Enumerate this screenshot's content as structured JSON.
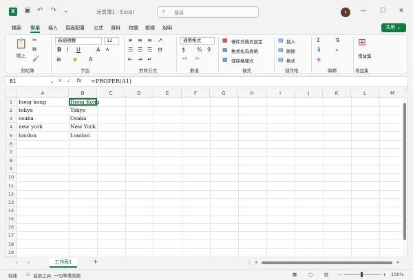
{
  "titlebar": {
    "logo": "X",
    "title": "活頁簿1 - Excel",
    "search_placeholder": "搜尋",
    "avatar_initial": "r",
    "icons": [
      "save-icon",
      "undo-icon",
      "redo-icon",
      "minimize-icon",
      "maximize-icon",
      "close-icon"
    ]
  },
  "tabs": [
    "檔案",
    "常用",
    "插入",
    "頁面配置",
    "公式",
    "資料",
    "校閱",
    "檢視",
    "說明"
  ],
  "share_label": "共用",
  "ribbon": {
    "clipboard": {
      "paste": "貼上",
      "label": "剪貼簿"
    },
    "font": {
      "name": "新細明體",
      "size": "12",
      "label": "字型",
      "bold": "B",
      "italic": "I",
      "underline": "U",
      "grow": "A",
      "shrink": "A"
    },
    "alignment": {
      "label": "對齊方式"
    },
    "number": {
      "format": "通用格式",
      "label": "數值",
      "percent": "%",
      "comma": "9"
    },
    "styles": {
      "conditional": "條件式格式設定",
      "as_table": "格式化為表格",
      "cell_styles": "儲存格樣式",
      "label": "樣式"
    },
    "cells": {
      "insert": "插入",
      "delete": "刪除",
      "format": "格式",
      "label": "儲存格"
    },
    "editing": {
      "label": "編輯"
    },
    "addins": {
      "button": "增益集",
      "label": "增益集"
    }
  },
  "formula_bar": {
    "name_box": "B1",
    "fx": "fx",
    "formula": "=PROPER(A1)"
  },
  "columns": [
    "A",
    "B",
    "C",
    "D",
    "E",
    "F",
    "G",
    "H",
    "I",
    "J",
    "K",
    "L",
    "M"
  ],
  "rows": [
    "1",
    "2",
    "3",
    "4",
    "5",
    "6",
    "7",
    "8",
    "9",
    "10",
    "11",
    "12",
    "13",
    "14",
    "15",
    "16",
    "17",
    "18",
    "19"
  ],
  "cells": [
    {
      "a": "hong kong",
      "b": "Hong Kong"
    },
    {
      "a": "tokyo",
      "b": "Tokyo"
    },
    {
      "a": "osaka",
      "b": "Osaka"
    },
    {
      "a": "new york",
      "b": "New York"
    },
    {
      "a": "london",
      "b": "London"
    }
  ],
  "sheet_tab": "工作表1",
  "status": {
    "ready": "就緒",
    "accessibility": "協助工具: 一切準備就緒",
    "zoom": "100%"
  }
}
